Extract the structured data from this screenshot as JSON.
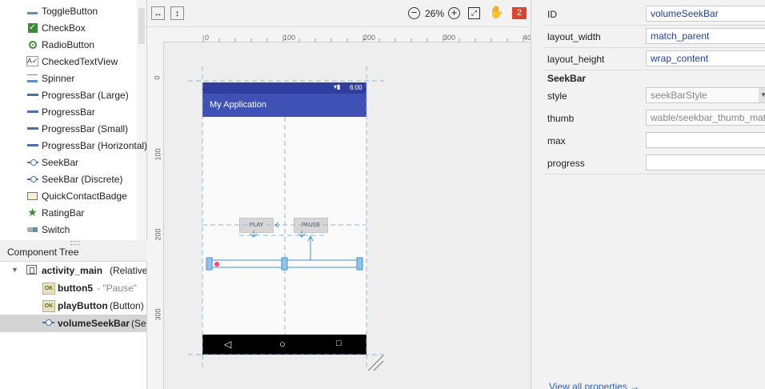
{
  "palette": {
    "items": [
      {
        "label": "ToggleButton",
        "icon": "toggle-button-icon"
      },
      {
        "label": "CheckBox",
        "icon": "checkbox-icon"
      },
      {
        "label": "RadioButton",
        "icon": "radio-button-icon"
      },
      {
        "label": "CheckedTextView",
        "icon": "checked-text-view-icon"
      },
      {
        "label": "Spinner",
        "icon": "spinner-icon"
      },
      {
        "label": "ProgressBar (Large)",
        "icon": "progressbar-icon"
      },
      {
        "label": "ProgressBar",
        "icon": "progressbar-icon"
      },
      {
        "label": "ProgressBar (Small)",
        "icon": "progressbar-icon"
      },
      {
        "label": "ProgressBar (Horizontal)",
        "icon": "progressbar-icon"
      },
      {
        "label": "SeekBar",
        "icon": "seekbar-icon"
      },
      {
        "label": "SeekBar (Discrete)",
        "icon": "seekbar-icon"
      },
      {
        "label": "QuickContactBadge",
        "icon": "contact-badge-icon"
      },
      {
        "label": "RatingBar",
        "icon": "star-icon"
      },
      {
        "label": "Switch",
        "icon": "switch-icon"
      }
    ]
  },
  "component_tree": {
    "title": "Component Tree",
    "root": {
      "name": "activity_main",
      "detail": "(RelativeLa"
    },
    "children": [
      {
        "name": "button5",
        "detail": "- \"Pause\""
      },
      {
        "name": "playButton",
        "detail": "(Button)"
      },
      {
        "name": "volumeSeekBar",
        "detail": "(Se"
      }
    ]
  },
  "toolbar": {
    "zoom": "26%",
    "error_count": "2"
  },
  "rulers": {
    "top": [
      "0",
      "100",
      "200",
      "300",
      "40"
    ],
    "left": [
      "0",
      "100",
      "200",
      "300"
    ]
  },
  "device": {
    "status_time": "6:00",
    "app_title": "My Application",
    "play_label": "PLAY",
    "pause_label": "PAUSE"
  },
  "properties": {
    "rows": [
      {
        "label": "ID",
        "value": "volumeSeekBar"
      },
      {
        "label": "layout_width",
        "value": "match_parent"
      },
      {
        "label": "layout_height",
        "value": "wrap_content"
      }
    ],
    "section": "SeekBar",
    "seek_rows": [
      {
        "label": "style",
        "value": "seekBarStyle"
      },
      {
        "label": "thumb",
        "value": "wable/seekbar_thumb_mate"
      },
      {
        "label": "max",
        "value": ""
      },
      {
        "label": "progress",
        "value": ""
      }
    ],
    "view_all": "View all properties"
  },
  "colors": {
    "accent": "#3f51b5",
    "status": "#303f9f",
    "blueprint": "#4a90c8",
    "error_badge": "#d9442b",
    "thumb": "#ff4081"
  }
}
